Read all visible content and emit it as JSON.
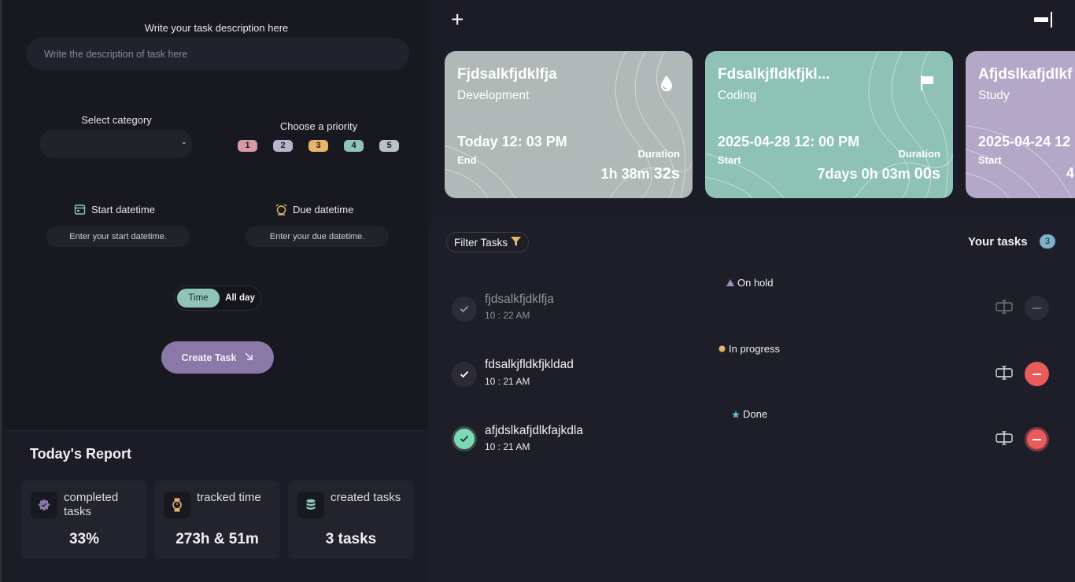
{
  "form": {
    "description_label": "Write your task description here",
    "description_placeholder": "Write the description of task here",
    "category_label": "Select category",
    "category_value": "",
    "priority_label": "Choose a priority",
    "priorities": [
      {
        "label": "1",
        "color": "#d79aa3"
      },
      {
        "label": "2",
        "color": "#b9b3cc"
      },
      {
        "label": "3",
        "color": "#e9b56a"
      },
      {
        "label": "4",
        "color": "#8ec5b6"
      },
      {
        "label": "5",
        "color": "#b9c2c4"
      }
    ],
    "start_label": "Start datetime",
    "start_placeholder": "Enter your start datetime.",
    "due_label": "Due datetime",
    "due_placeholder": "Enter your due datetime.",
    "toggle_time": "Time",
    "toggle_allday": "All day",
    "create_label": "Create Task"
  },
  "report": {
    "title": "Today's Report",
    "stats": [
      {
        "label": "completed tasks",
        "value": "33%",
        "icon": "badge-check-icon",
        "color": "#8a79a8"
      },
      {
        "label": "tracked time",
        "value": "273h & 51m",
        "icon": "watch-icon",
        "color": "#e9b56a"
      },
      {
        "label": "created tasks",
        "value": "3 tasks",
        "icon": "database-icon",
        "color": "#8ec5b6"
      }
    ]
  },
  "cards": [
    {
      "title": "Fjdsalkfjdklfja",
      "category": "Development",
      "date": "Today 12: 03 PM",
      "when": "End",
      "duration_label": "Duration",
      "duration_main": "1h 38m",
      "duration_sec": "32s",
      "icon": "drop-icon",
      "bg": "#b0b9b7"
    },
    {
      "title": "Fdsalkjfldkfjkl...",
      "category": "Coding",
      "date": "2025-04-28 12: 00 PM",
      "when": "Start",
      "duration_label": "Duration",
      "duration_main": "7days 0h 03m",
      "duration_sec": "00s",
      "icon": "flag-icon",
      "bg": "#8ec2b5"
    },
    {
      "title": "Afjdslkafjdlkf",
      "category": "Study",
      "date": "2025-04-24 12",
      "when": "Start",
      "duration_label": "",
      "duration_main": "4",
      "duration_sec": "",
      "icon": "",
      "bg": "#b3a8c8"
    }
  ],
  "tasks_panel": {
    "filter_label": "Filter Tasks",
    "title": "Your tasks",
    "count": "3"
  },
  "tasks": [
    {
      "name": "fjdsalkfjdklfja",
      "time": "10 : 22 AM",
      "status": "On hold",
      "status_color": "#9a8fc0",
      "status_shape": "triangle",
      "checked": false
    },
    {
      "name": "fdsalkjfldkfjkldad",
      "time": "10 : 21 AM",
      "status": "In progress",
      "status_color": "#e9b56a",
      "status_shape": "dot",
      "checked": false
    },
    {
      "name": "afjdslkafjdlkfajkdla",
      "time": "10 : 21 AM",
      "status": "Done",
      "status_color": "#6fb6d6",
      "status_shape": "star",
      "checked": true
    }
  ]
}
